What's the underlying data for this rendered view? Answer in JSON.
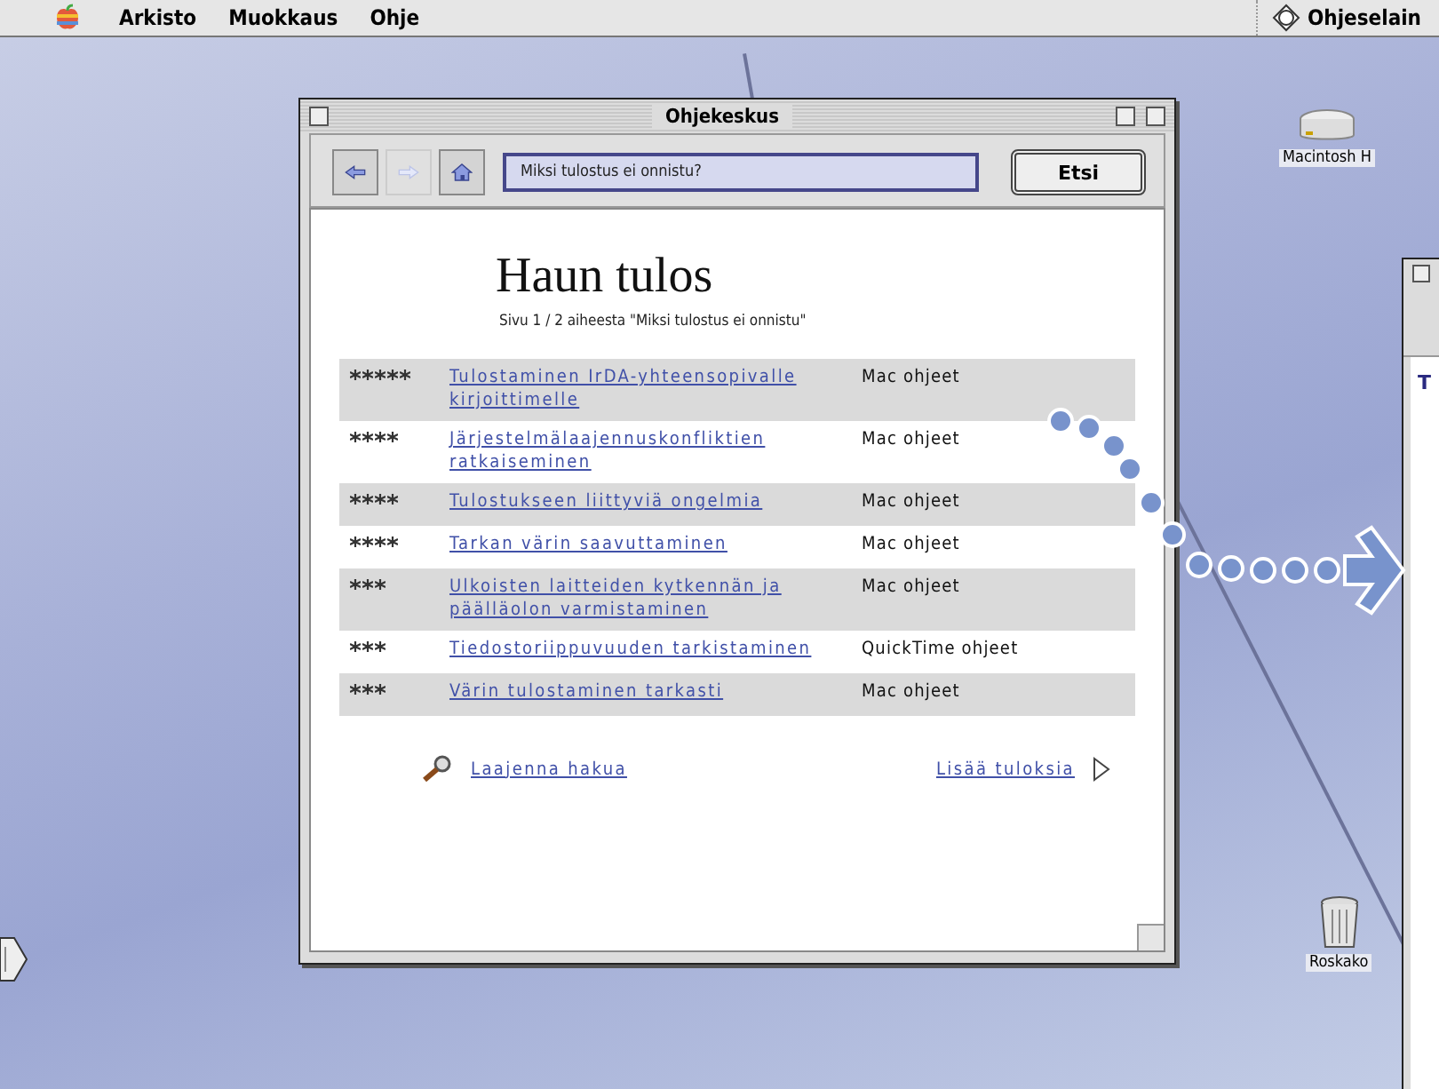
{
  "menu_bar": {
    "items": [
      "Arkisto",
      "Muokkaus",
      "Ohje"
    ],
    "app": "Ohjeselain"
  },
  "desktop_icons": [
    {
      "label": "Macintosh H",
      "kind": "disk"
    },
    {
      "label": "Roskako",
      "kind": "trash"
    }
  ],
  "window": {
    "title": "Ohjekeskus",
    "search": {
      "value": "Miksi tulostus ei onnistu?",
      "button": "Etsi"
    },
    "heading": "Haun tulos",
    "subtitle": "Sivu 1 / 2 aiheesta \"Miksi tulostus ei onnistu\"",
    "results": [
      {
        "stars": 5,
        "title": "Tulostaminen IrDA-yhteensopivalle kirjoittimelle",
        "source": "Mac ohjeet"
      },
      {
        "stars": 4,
        "title": "Järjestelmälaajennuskonfliktien ratkaiseminen",
        "source": "Mac ohjeet"
      },
      {
        "stars": 4,
        "title": "Tulostukseen liittyviä ongelmia",
        "source": "Mac ohjeet"
      },
      {
        "stars": 4,
        "title": "Tarkan värin saavuttaminen",
        "source": "Mac ohjeet"
      },
      {
        "stars": 3,
        "title": "Ulkoisten laitteiden kytkennän ja päälläolon varmistaminen",
        "source": "Mac ohjeet"
      },
      {
        "stars": 3,
        "title": "Tiedostoriippuvuuden tarkistaminen",
        "source": "QuickTime ohjeet"
      },
      {
        "stars": 3,
        "title": "Värin tulostaminen tarkasti",
        "source": "Mac ohjeet"
      }
    ],
    "footer": {
      "expand_link": "Laajenna hakua",
      "more_link": "Lisää tuloksia"
    }
  },
  "second_window": {
    "text": "T"
  }
}
